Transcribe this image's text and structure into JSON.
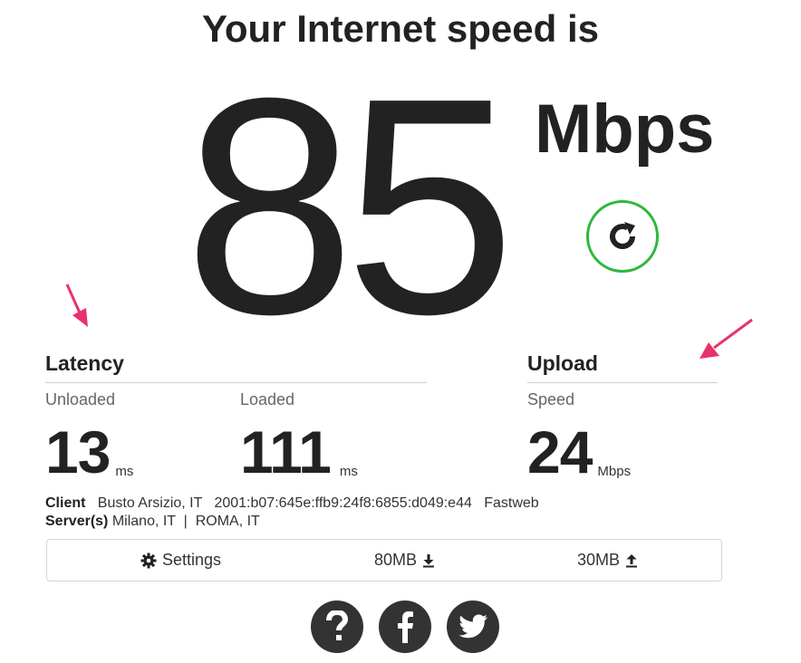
{
  "headline": "Your Internet speed is",
  "speed": {
    "value": "85",
    "units": "Mbps"
  },
  "latency": {
    "title": "Latency",
    "unloaded": {
      "label": "Unloaded",
      "value": "13",
      "unit": "ms"
    },
    "loaded": {
      "label": "Loaded",
      "value": "111",
      "unit": "ms"
    }
  },
  "upload": {
    "title": "Upload",
    "label": "Speed",
    "value": "24",
    "unit": "Mbps"
  },
  "client": {
    "label": "Client",
    "location": "Busto Arsizio, IT",
    "ip": "2001:b07:645e:ffb9:24f8:6855:d049:e44",
    "isp": "Fastweb"
  },
  "servers": {
    "label": "Server(s)",
    "list": "Milano, IT  |  ROMA, IT"
  },
  "settings_bar": {
    "settings_label": "Settings",
    "download_size": "80MB",
    "upload_size": "30MB"
  },
  "colors": {
    "refresh_ring": "#2db83d",
    "social_bg": "#333333",
    "annotation_arrow": "#e8336a"
  },
  "icons": [
    "refresh-icon",
    "gear-icon",
    "download-icon",
    "upload-icon",
    "help-icon",
    "facebook-icon",
    "twitter-icon"
  ]
}
